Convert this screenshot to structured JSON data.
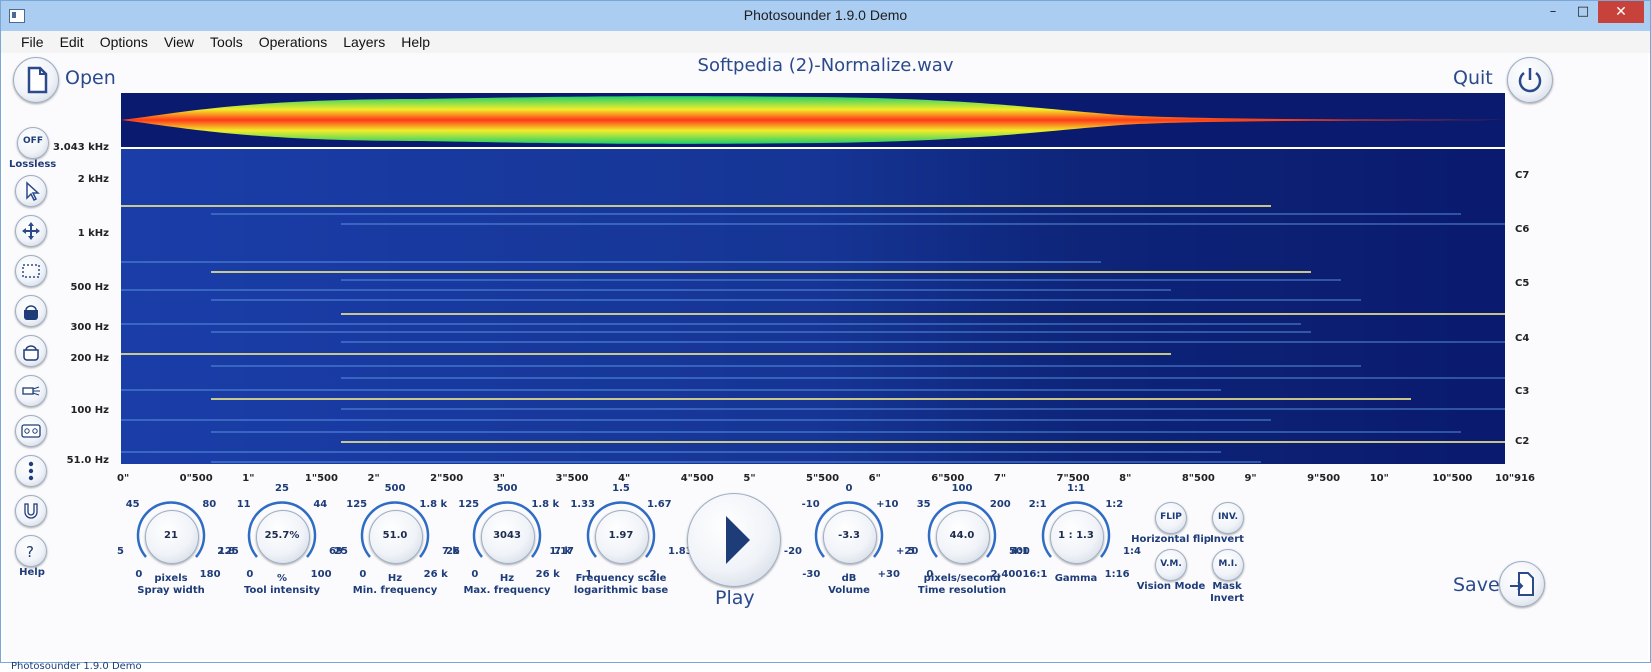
{
  "window": {
    "title": "Photosounder 1.9.0 Demo",
    "min": "–",
    "max": "□",
    "close": "✕"
  },
  "menu": [
    "File",
    "Edit",
    "Options",
    "View",
    "Tools",
    "Operations",
    "Layers",
    "Help"
  ],
  "header": {
    "open_label": "Open",
    "file_title": "Softpedia (2)-Normalize.wav",
    "quit_label": "Quit",
    "save_label": "Save"
  },
  "lossless": {
    "button": "OFF",
    "label": "Lossless"
  },
  "help_label": "Help",
  "spectrum": {
    "freq_labels": [
      "3.043 kHz",
      "2 kHz",
      "1 kHz",
      "500 Hz",
      "300 Hz",
      "200 Hz",
      "100 Hz",
      "51.0 Hz"
    ],
    "note_labels": [
      "C7",
      "C6",
      "C5",
      "C4",
      "C3",
      "C2"
    ],
    "time_labels": [
      "0\"",
      "0\"500",
      "1\"",
      "1\"500",
      "2\"",
      "2\"500",
      "3\"",
      "3\"500",
      "4\"",
      "4\"500",
      "5\"",
      "5\"500",
      "6\"",
      "6\"500",
      "7\"",
      "7\"500",
      "8\"",
      "8\"500",
      "9\"",
      "9\"500",
      "10\"",
      "10\"500",
      "10\"916"
    ]
  },
  "knobs": [
    {
      "value": "21",
      "unit": "pixels",
      "caption": "Spray width",
      "scale": [
        "0",
        "5",
        "45",
        "80",
        "125",
        "180"
      ]
    },
    {
      "value": "25.7%",
      "unit": "%",
      "caption": "Tool intensity",
      "scale": [
        "0",
        "2.8",
        "11",
        "25",
        "44",
        "69",
        "100"
      ]
    },
    {
      "value": "51.0",
      "unit": "Hz",
      "caption": "Min. frequency",
      "scale": [
        "0",
        "25",
        "125",
        "500",
        "1.8 k",
        "7 k",
        "26 k"
      ]
    },
    {
      "value": "3043",
      "unit": "Hz",
      "caption": "Max. frequency",
      "scale": [
        "0",
        "25",
        "125",
        "500",
        "1.8 k",
        "7 k",
        "26 k"
      ]
    },
    {
      "value": "1.97",
      "unit": "Frequency scale",
      "caption": "logarithmic base",
      "scale": [
        "1",
        "1.17",
        "1.33",
        "1.5",
        "1.67",
        "1.83",
        "2"
      ]
    },
    {
      "value": "-3.3",
      "unit": "dB",
      "caption": "Volume",
      "scale": [
        "-30",
        "-20",
        "-10",
        "0",
        "+10",
        "+20",
        "+30"
      ]
    },
    {
      "value": "44.0",
      "unit": "pixels/second",
      "caption": "Time resolution",
      "scale": [
        "0",
        "5",
        "35",
        "100",
        "200",
        "500",
        "2,400"
      ]
    },
    {
      "value": "1 : 1.3",
      "unit": "Gamma",
      "caption": "",
      "scale": [
        "16:1",
        "4:1",
        "2:1",
        "1:1",
        "1:2",
        "1:4",
        "1:16"
      ]
    }
  ],
  "play_label": "Play",
  "toggles": [
    {
      "button": "FLIP",
      "label": "Horizontal flip"
    },
    {
      "button": "INV.",
      "label": "Invert"
    },
    {
      "button": "V.M.",
      "label": "Vision Mode"
    },
    {
      "button": "M.I.",
      "label": "Mask Invert"
    }
  ],
  "status": "Photosounder 1.9.0 Demo",
  "colors": {
    "accent": "#2b4a8c",
    "spectrum_bg": "#0a1a6e",
    "line": "#e8e28a"
  }
}
